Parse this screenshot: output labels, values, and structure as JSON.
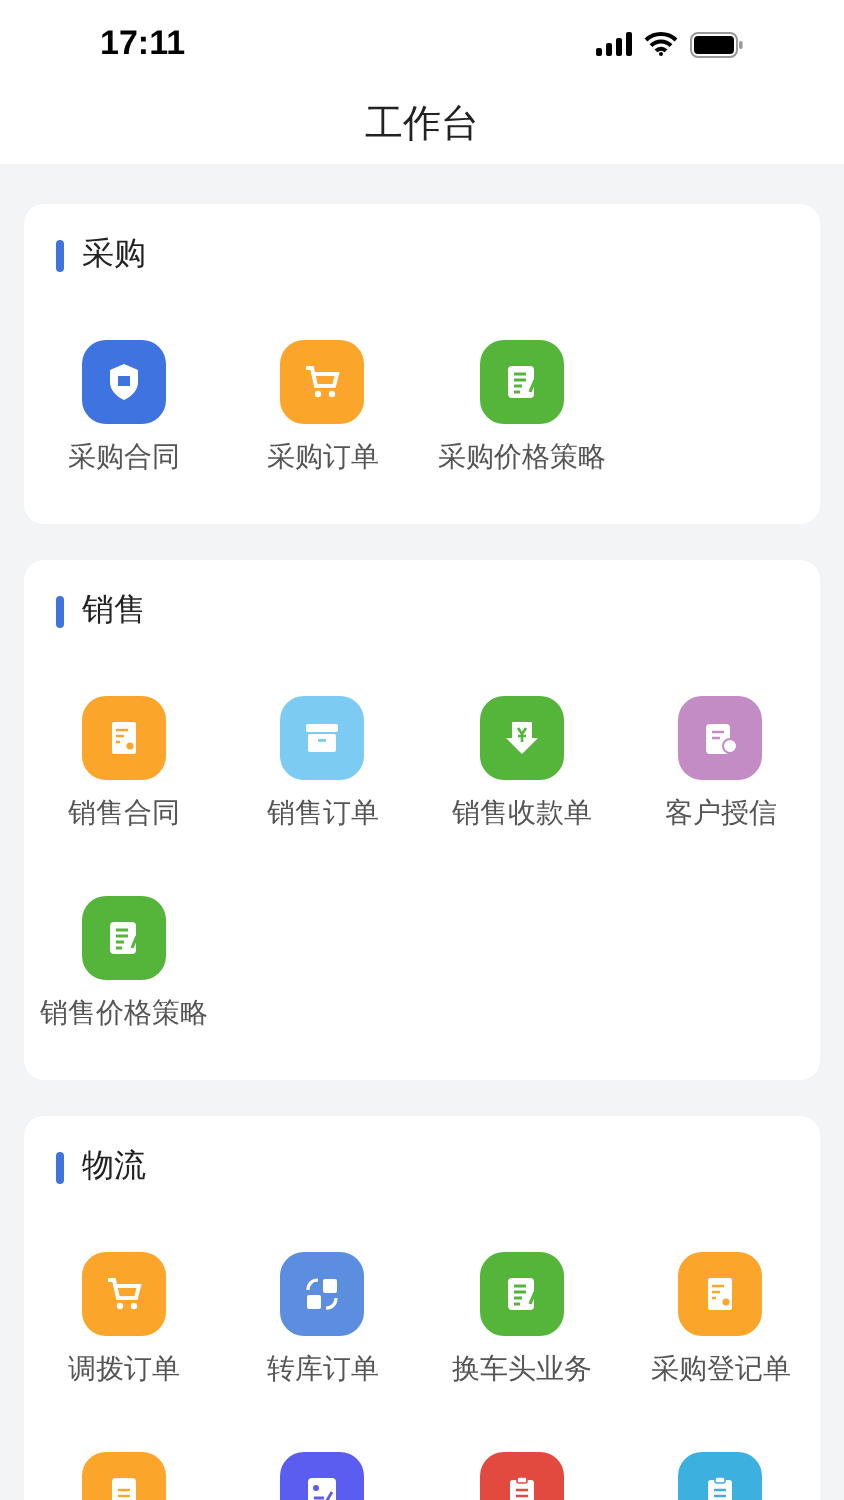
{
  "status_bar": {
    "time": "17:11"
  },
  "header": {
    "title": "工作台"
  },
  "sections": [
    {
      "title": "采购",
      "items": [
        {
          "label": "采购合同",
          "kind": "shield",
          "color": "#3f74e0"
        },
        {
          "label": "采购订单",
          "kind": "cart",
          "color": "#fba62a"
        },
        {
          "label": "采购价格策略",
          "kind": "doc-pen",
          "color": "#55b53b"
        }
      ]
    },
    {
      "title": "销售",
      "items": [
        {
          "label": "销售合同",
          "kind": "doc-star",
          "color": "#fba62a"
        },
        {
          "label": "销售订单",
          "kind": "box",
          "color": "#7ccbf3"
        },
        {
          "label": "销售收款单",
          "kind": "yen-down",
          "color": "#55b53b"
        },
        {
          "label": "客户授信",
          "kind": "clipboard-phone",
          "color": "#c38cc5"
        },
        {
          "label": "销售价格策略",
          "kind": "doc-pen",
          "color": "#55b53b"
        }
      ]
    },
    {
      "title": "物流",
      "items": [
        {
          "label": "调拨订单",
          "kind": "cart",
          "color": "#fba62a"
        },
        {
          "label": "转库订单",
          "kind": "swap",
          "color": "#5b8ede"
        },
        {
          "label": "换车头业务",
          "kind": "doc-pen",
          "color": "#55b53b"
        },
        {
          "label": "采购登记单",
          "kind": "doc-star",
          "color": "#fba62a"
        },
        {
          "kind": "scroll",
          "color": "#fba62a"
        },
        {
          "kind": "doc-edit",
          "color": "#5b5cf0"
        },
        {
          "kind": "clipboard",
          "color": "#e24a3f"
        },
        {
          "kind": "clipboard",
          "color": "#3cb1e0"
        }
      ]
    }
  ]
}
